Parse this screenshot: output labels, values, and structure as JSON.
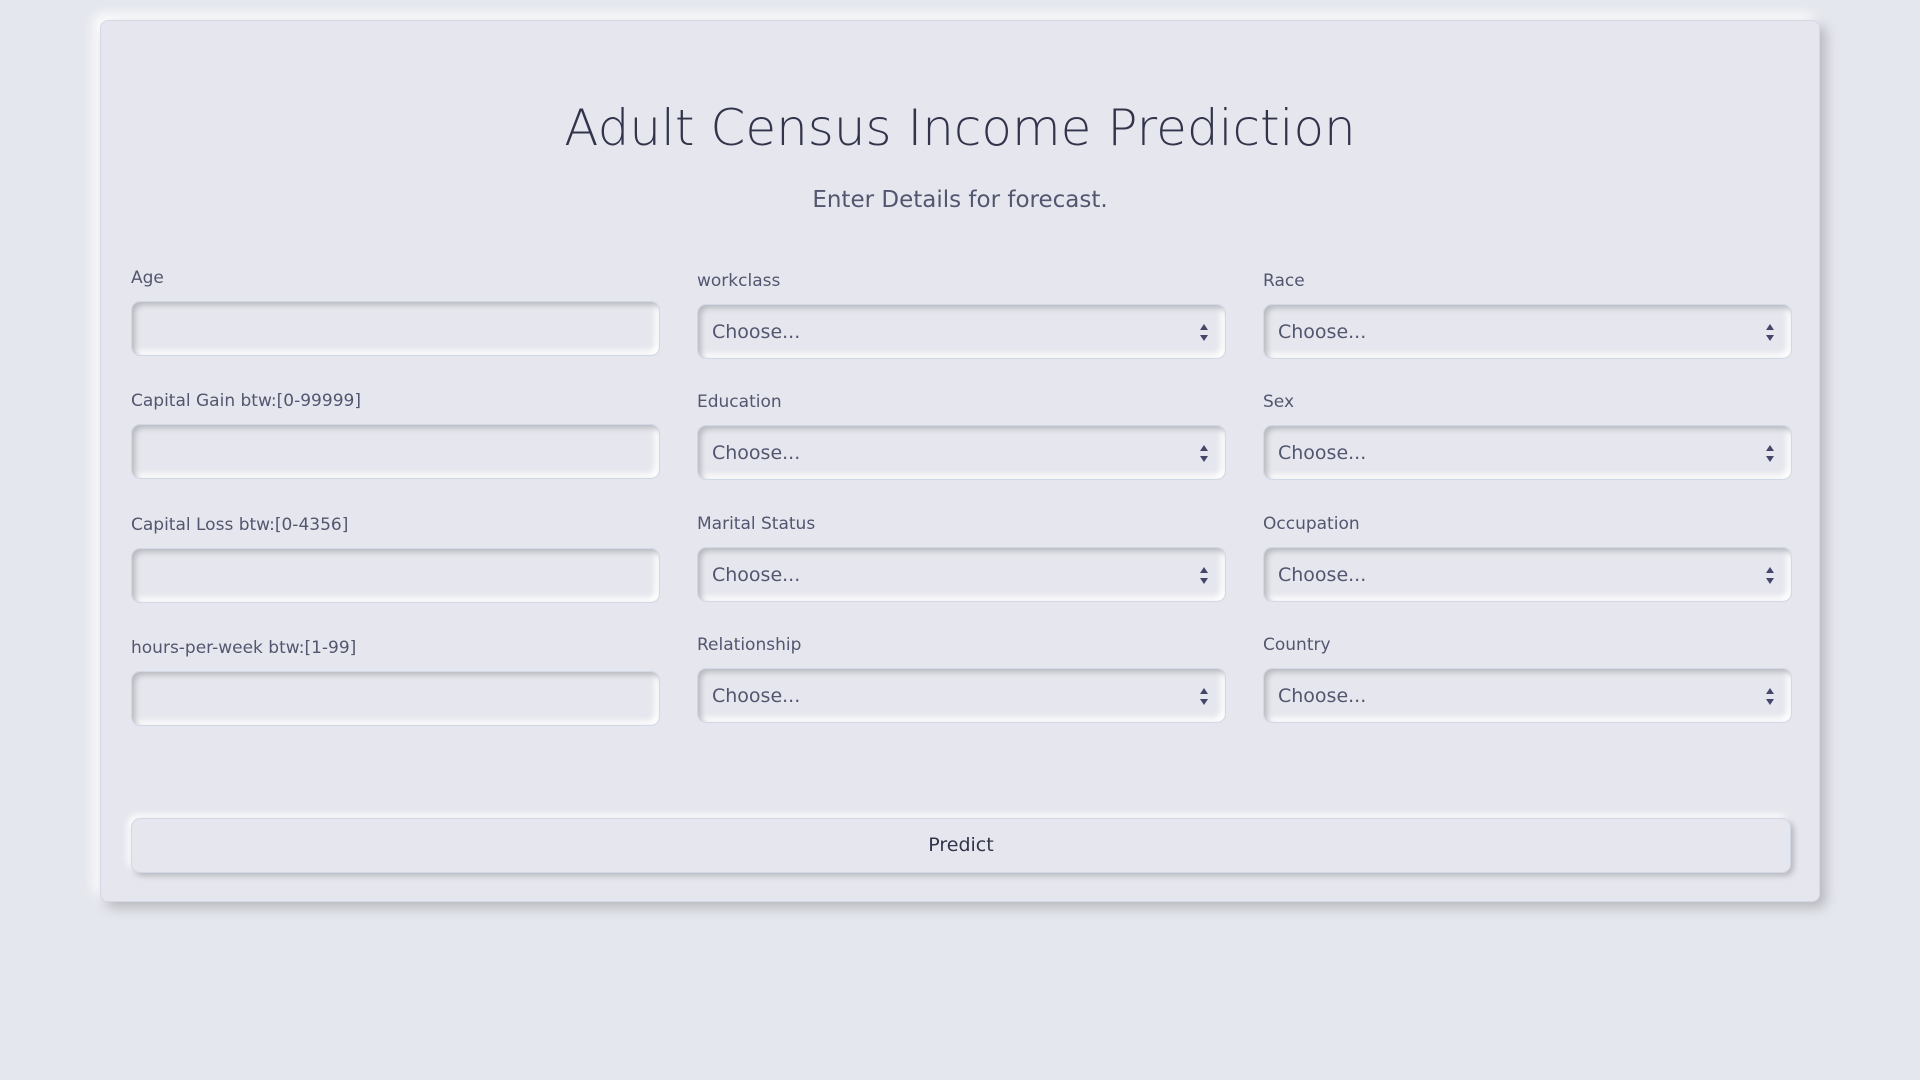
{
  "header": {
    "title": "Adult Census Income Prediction",
    "subtitle": "Enter Details for forecast."
  },
  "form": {
    "col1": [
      {
        "label": "Age",
        "value": ""
      },
      {
        "label": "Capital Gain btw:[0-99999]",
        "value": ""
      },
      {
        "label": "Capital Loss btw:[0-4356]",
        "value": ""
      },
      {
        "label": "hours-per-week btw:[1-99]",
        "value": ""
      }
    ],
    "col2": [
      {
        "label": "workclass",
        "selected": "Choose..."
      },
      {
        "label": "Education",
        "selected": "Choose..."
      },
      {
        "label": "Marital Status",
        "selected": "Choose..."
      },
      {
        "label": "Relationship",
        "selected": "Choose..."
      }
    ],
    "col3": [
      {
        "label": "Race",
        "selected": "Choose..."
      },
      {
        "label": "Sex",
        "selected": "Choose..."
      },
      {
        "label": "Occupation",
        "selected": "Choose..."
      },
      {
        "label": "Country",
        "selected": "Choose..."
      }
    ],
    "predict_label": "Predict"
  },
  "icons": {
    "select_arrow": "chevron-updown-icon"
  },
  "colors": {
    "background": "#e6e7ee",
    "text": "#44476a",
    "title": "#31344b"
  }
}
